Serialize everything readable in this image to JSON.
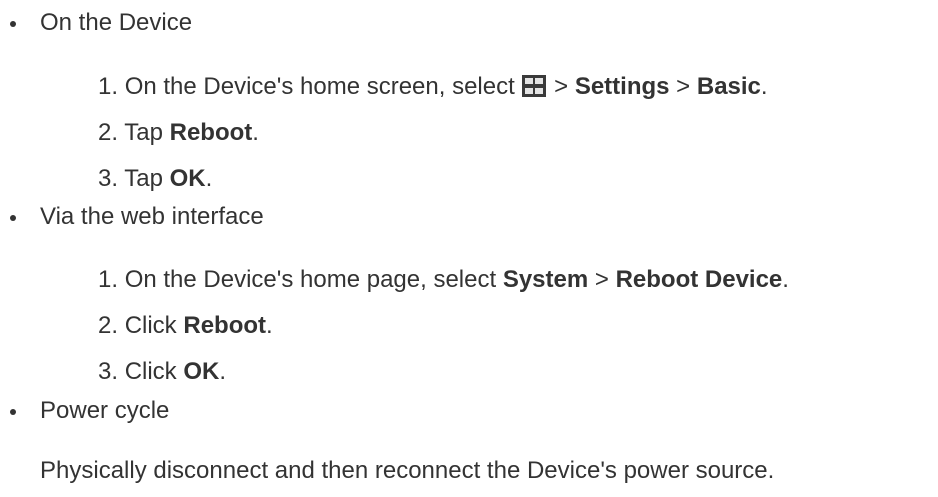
{
  "sections": [
    {
      "title": "On the Device",
      "steps": [
        {
          "num": "1. ",
          "pre": "On the Device's home screen, select ",
          "icon": "grid-menu-icon",
          "mid1": " > ",
          "b1": "Settings",
          "mid2": " > ",
          "b2": "Basic",
          "end": "."
        },
        {
          "num": "2. ",
          "pre": "Tap ",
          "b1": "Reboot",
          "end": "."
        },
        {
          "num": "3. ",
          "pre": "Tap ",
          "b1": "OK",
          "end": "."
        }
      ]
    },
    {
      "title": "Via the web interface",
      "steps": [
        {
          "num": "1. ",
          "pre": "On the Device's home page, select ",
          "b1": "System",
          "mid1": " > ",
          "b2": "Reboot Device",
          "end": "."
        },
        {
          "num": "2. ",
          "pre": "Click ",
          "b1": "Reboot",
          "end": "."
        },
        {
          "num": "3. ",
          "pre": "Click ",
          "b1": "OK",
          "end": "."
        }
      ]
    },
    {
      "title": "Power cycle",
      "description": "Physically disconnect and then reconnect the Device's power source."
    }
  ]
}
